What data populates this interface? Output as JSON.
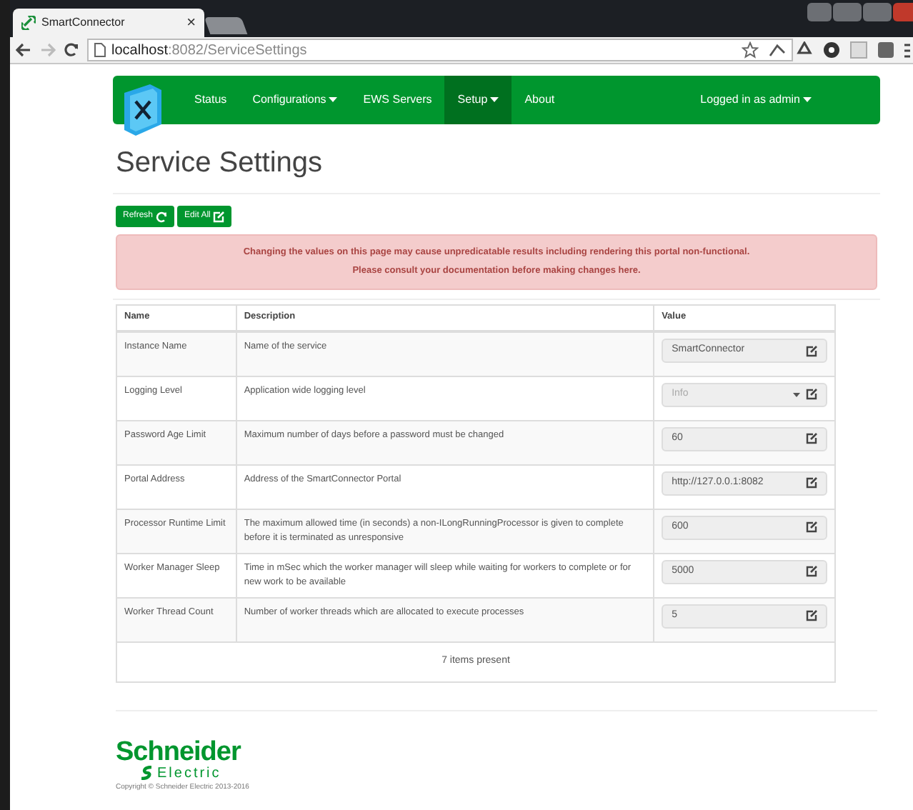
{
  "browser": {
    "tab": {
      "title": "SmartConnector",
      "close": "×"
    },
    "address": {
      "host": "localhost",
      "path": ":8082/ServiceSettings"
    }
  },
  "navbar": {
    "items": [
      {
        "label": "Status",
        "dropdown": false,
        "selected": false
      },
      {
        "label": "Configurations",
        "dropdown": true,
        "selected": false
      },
      {
        "label": "EWS Servers",
        "dropdown": false,
        "selected": false
      },
      {
        "label": "Setup",
        "dropdown": true,
        "selected": true
      },
      {
        "label": "About",
        "dropdown": false,
        "selected": false
      }
    ],
    "user": "Logged in as admin"
  },
  "page_title": "Service Settings",
  "buttons": [
    {
      "label": "Refresh",
      "kind": "refresh"
    },
    {
      "label": "Edit All",
      "kind": "edit"
    }
  ],
  "alert": [
    "Changing the values on this page may cause unpredicatable results including rendering this portal non-functional.",
    "Please consult your documentation before making changes here."
  ],
  "table": {
    "columns": [
      "Name",
      "Description",
      "Value"
    ],
    "rows": [
      {
        "name": "Instance Name",
        "description": "Name of the service",
        "value": "SmartConnector",
        "kind": "text",
        "disabled": false
      },
      {
        "name": "Logging Level",
        "description": "Application wide logging level",
        "value": "Info",
        "kind": "select",
        "disabled": true
      },
      {
        "name": "Password Age Limit",
        "description": "Maximum number of days before a password must be changed",
        "value": "60",
        "kind": "text",
        "disabled": false
      },
      {
        "name": "Portal Address",
        "description": "Address of the SmartConnector Portal",
        "value": "http://127.0.0.1:8082",
        "kind": "text",
        "disabled": false
      },
      {
        "name": "Processor Runtime Limit",
        "description": "The maximum allowed time (in seconds) a non-ILongRunningProcessor is given to complete before it is terminated as unresponsive",
        "value": "600",
        "kind": "text",
        "disabled": false
      },
      {
        "name": "Worker Manager Sleep",
        "description": "Time in mSec which the worker manager will sleep while waiting for workers to complete or for new work to be available",
        "value": "5000",
        "kind": "text",
        "disabled": false
      },
      {
        "name": "Worker Thread Count",
        "description": "Number of worker threads which are allocated to execute processes",
        "value": "5",
        "kind": "text",
        "disabled": false
      }
    ],
    "footer": "7 items present"
  },
  "footer": {
    "logo_name": "Schneider",
    "logo_sub": "Electric",
    "copyright": "Copyright © Schneider Electric 2013-2016"
  }
}
